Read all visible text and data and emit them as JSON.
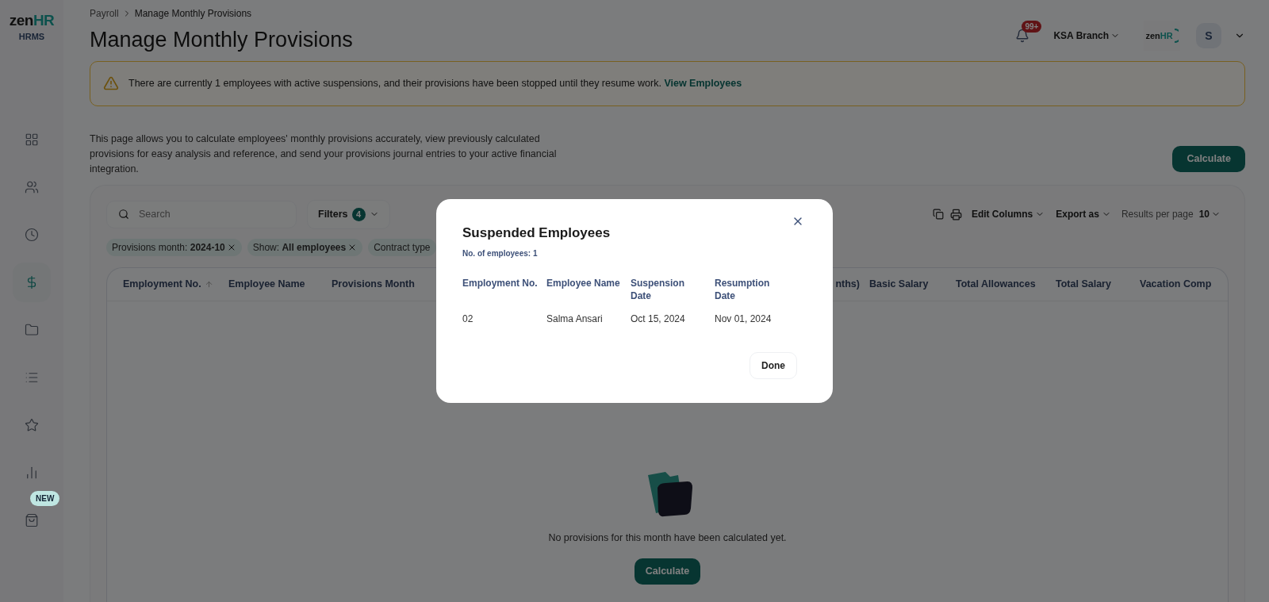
{
  "sidebar": {
    "logo": {
      "word": "zen",
      "accent": "HR"
    },
    "product": "HRMS",
    "items": [
      {
        "selected": false
      },
      {
        "selected": false
      },
      {
        "selected": false
      },
      {
        "selected": true
      },
      {
        "selected": false
      },
      {
        "selected": false
      },
      {
        "selected": false
      },
      {
        "selected": false
      },
      {
        "selected": false,
        "badge": "NEW"
      }
    ]
  },
  "header": {
    "breadcrumb": [
      "Payroll",
      "Manage Monthly Provisions"
    ],
    "title": "Manage Monthly Provisions",
    "notifications": "99+",
    "branch": "KSA Branch",
    "logo": {
      "word": "zen",
      "accent": "HR"
    },
    "avatar": "S"
  },
  "alert": {
    "text": "There are currently 1 employees with active suspensions, and their provisions have been stopped until they resume work.",
    "link": "View Employees"
  },
  "description": "This page allows you to calculate employees' monthly provisions accurately, view previously calculated provisions for easy analysis and reference, and send your provisions journal entries to your active financial integration.",
  "calculate_button": "Calculate",
  "toolbar": {
    "search": {
      "placeholder": "Search"
    },
    "filters": {
      "label": "Filters",
      "count": "4"
    },
    "edit_columns": "Edit Columns",
    "export": "Export as",
    "results_label": "Results per page",
    "results_value": "10"
  },
  "chips": [
    {
      "text": "Provisions month: **2024-10**",
      "removable": true
    },
    {
      "text": "Show: **All employees**",
      "removable": true
    },
    {
      "text": "Contract type",
      "removable": false
    }
  ],
  "table": {
    "columns": [
      {
        "label": "Employment No.",
        "sorted": true
      },
      {
        "label": "Employee Name",
        "sorted": false
      },
      {
        "label": "Provisions Month",
        "sorted": false
      },
      {
        "label": "nths)",
        "sorted": false
      },
      {
        "label": "Basic Salary",
        "sorted": false
      },
      {
        "label": "Total Allowances",
        "sorted": false
      },
      {
        "label": "Total Salary",
        "sorted": false
      },
      {
        "label": "Vacation Comp",
        "sorted": false
      }
    ],
    "empty_text": "No provisions for this month have been calculated yet.",
    "empty_button": "Calculate"
  },
  "modal": {
    "title": "Suspended Employees",
    "count": "No. of employees: 1",
    "columns": [
      "Employment No.",
      "Employee Name",
      "Suspension Date",
      "Resumption Date"
    ],
    "rows": [
      [
        "02",
        "Salma Ansari",
        "Oct 15, 2024",
        "Nov 01, 2024"
      ]
    ],
    "done": "Done"
  }
}
